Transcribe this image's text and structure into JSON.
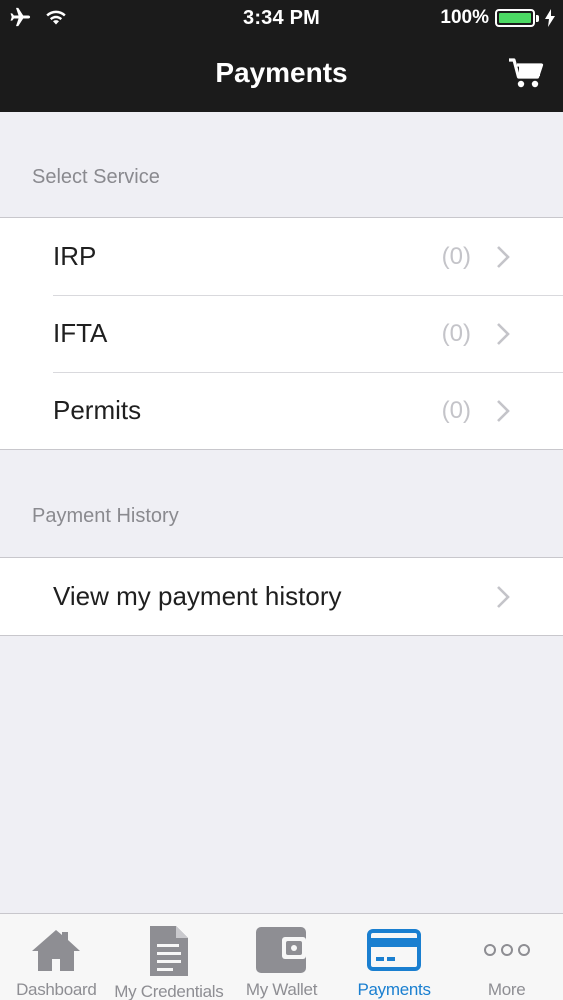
{
  "status_bar": {
    "time": "3:34 PM",
    "battery_percent": "100%",
    "icons": [
      "airplane-icon",
      "wifi-icon",
      "battery-icon",
      "charging-bolt-icon"
    ]
  },
  "header": {
    "title": "Payments",
    "cart_icon": "cart-icon"
  },
  "select_service": {
    "header": "Select Service",
    "items": [
      {
        "label": "IRP",
        "count": "(0)"
      },
      {
        "label": "IFTA",
        "count": "(0)"
      },
      {
        "label": "Permits",
        "count": "(0)"
      }
    ]
  },
  "payment_history": {
    "header": "Payment History",
    "items": [
      {
        "label": "View my payment history"
      }
    ]
  },
  "tabbar": {
    "tabs": [
      {
        "label": "Dashboard",
        "icon": "house-icon",
        "active": false
      },
      {
        "label": "My Credentials",
        "icon": "document-icon",
        "active": false
      },
      {
        "label": "My Wallet",
        "icon": "wallet-icon",
        "active": false
      },
      {
        "label": "Payments",
        "icon": "credit-card-icon",
        "active": true
      },
      {
        "label": "More",
        "icon": "more-dots-icon",
        "active": false
      }
    ]
  },
  "colors": {
    "header_bg": "#1b1b1b",
    "page_bg": "#efeff4",
    "active_tab": "#1a7fd0",
    "inactive_tab": "#8e8e93",
    "battery": "#4cd964"
  }
}
